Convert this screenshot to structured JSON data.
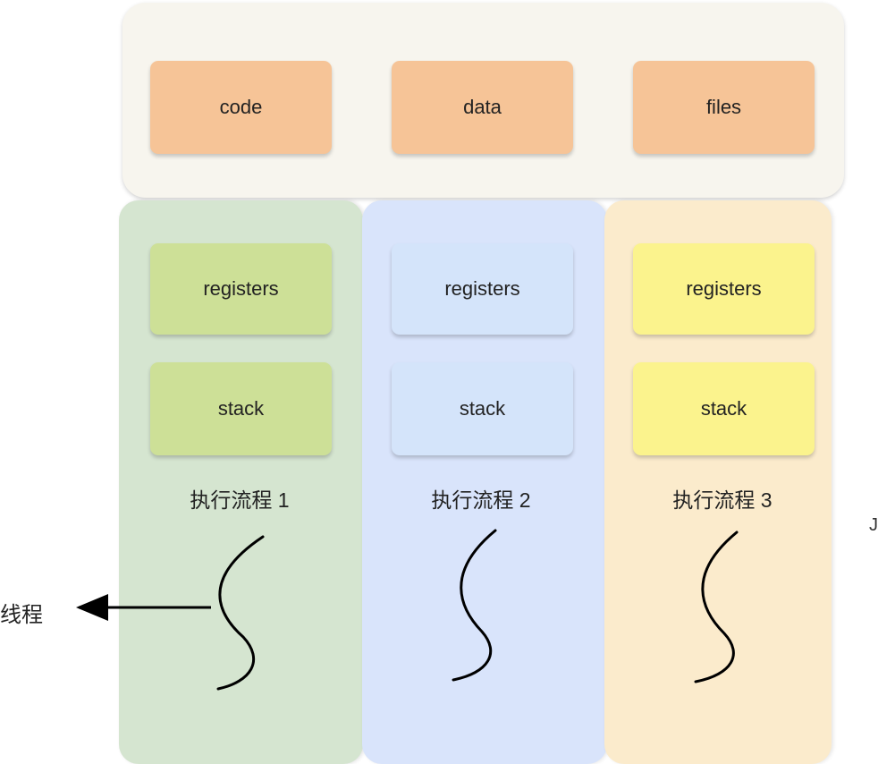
{
  "shared_resources": [
    {
      "label": "code"
    },
    {
      "label": "data"
    },
    {
      "label": "files"
    }
  ],
  "threads": [
    {
      "registers": "registers",
      "stack": "stack",
      "flow_label": "执行流程 1",
      "color": "#d5e5d0",
      "box_color": "#cde097"
    },
    {
      "registers": "registers",
      "stack": "stack",
      "flow_label": "执行流程 2",
      "color": "#d9e4fb",
      "box_color": "#d4e4fa"
    },
    {
      "registers": "registers",
      "stack": "stack",
      "flow_label": "执行流程 3",
      "color": "#fbebcc",
      "box_color": "#fbf38d"
    }
  ],
  "thread_pointer_label": "线程",
  "edge_mark": "J",
  "colors": {
    "resource_box": "#f6c497",
    "shared_panel": "#f7f5ee",
    "arrow": "#000000"
  }
}
